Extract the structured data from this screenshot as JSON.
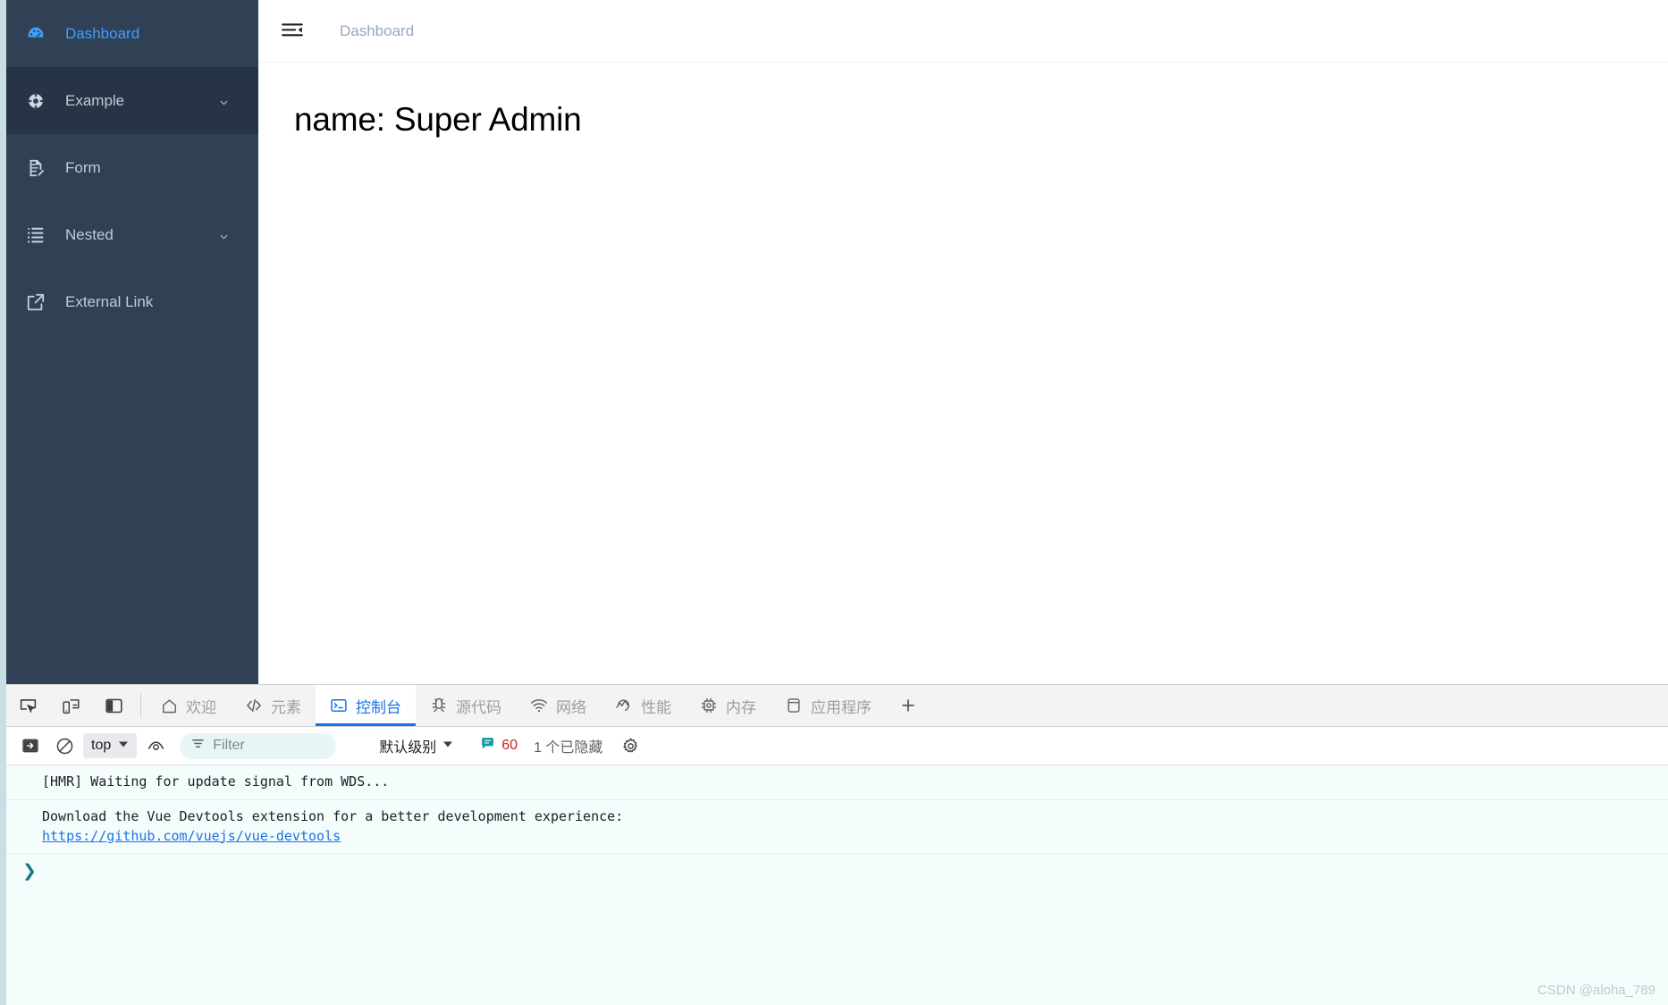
{
  "app": {
    "sidebar": {
      "items": [
        {
          "label": "Dashboard",
          "icon": "dashboard-gauge-icon",
          "state": "active",
          "arrow": false
        },
        {
          "label": "Example",
          "icon": "compass-icon",
          "state": "highlight",
          "arrow": true
        },
        {
          "label": "Form",
          "icon": "form-document-icon",
          "state": "normal",
          "arrow": false
        },
        {
          "label": "Nested",
          "icon": "nested-list-icon",
          "state": "normal",
          "arrow": true
        },
        {
          "label": "External Link",
          "icon": "external-link-icon",
          "state": "normal",
          "arrow": false
        }
      ]
    },
    "header": {
      "hamburger_icon": "hamburger-collapse-icon",
      "breadcrumb": "Dashboard"
    },
    "main": {
      "title": "name: Super Admin"
    }
  },
  "devtools": {
    "tools": [
      {
        "icon": "inspect-element-icon"
      },
      {
        "icon": "device-toolbar-icon"
      },
      {
        "icon": "dock-side-icon"
      }
    ],
    "tabs": [
      {
        "label": "欢迎",
        "icon": "home-icon",
        "selected": false
      },
      {
        "label": "元素",
        "icon": "code-brackets-icon",
        "selected": false
      },
      {
        "label": "控制台",
        "icon": "console-icon",
        "selected": true
      },
      {
        "label": "源代码",
        "icon": "bug-icon",
        "selected": false
      },
      {
        "label": "网络",
        "icon": "wifi-icon",
        "selected": false
      },
      {
        "label": "性能",
        "icon": "performance-icon",
        "selected": false
      },
      {
        "label": "内存",
        "icon": "memory-chip-icon",
        "selected": false
      },
      {
        "label": "应用程序",
        "icon": "application-icon",
        "selected": false
      }
    ],
    "more_tabs_label": "+",
    "console_toolbar": {
      "sidebar_toggle_icon": "console-sidebar-icon",
      "clear_icon": "clear-console-icon",
      "context_value": "top",
      "live_expression_icon": "eye-icon",
      "filter_placeholder": "Filter",
      "filter_value": "",
      "filter_icon": "filter-icon",
      "level_value": "默认级别",
      "message_count": "60",
      "message_icon": "speech-bubble-icon",
      "hidden_count": "1 个已隐藏",
      "settings_icon": "gear-icon"
    },
    "console_logs": [
      {
        "text": "[HMR] Waiting for update signal from WDS...",
        "link": null
      },
      {
        "text": "Download the Vue Devtools extension for a better development experience:",
        "link": "https://github.com/vuejs/vue-devtools"
      }
    ],
    "prompt_chevron": "❯"
  },
  "watermark": "CSDN @aloha_789",
  "colors": {
    "sidebar_bg": "#304156",
    "sidebar_active_text": "#409eff",
    "sidebar_highlight_bg": "#263445",
    "devtools_accent": "#1a73e8",
    "console_bg": "#f4fcfc"
  }
}
